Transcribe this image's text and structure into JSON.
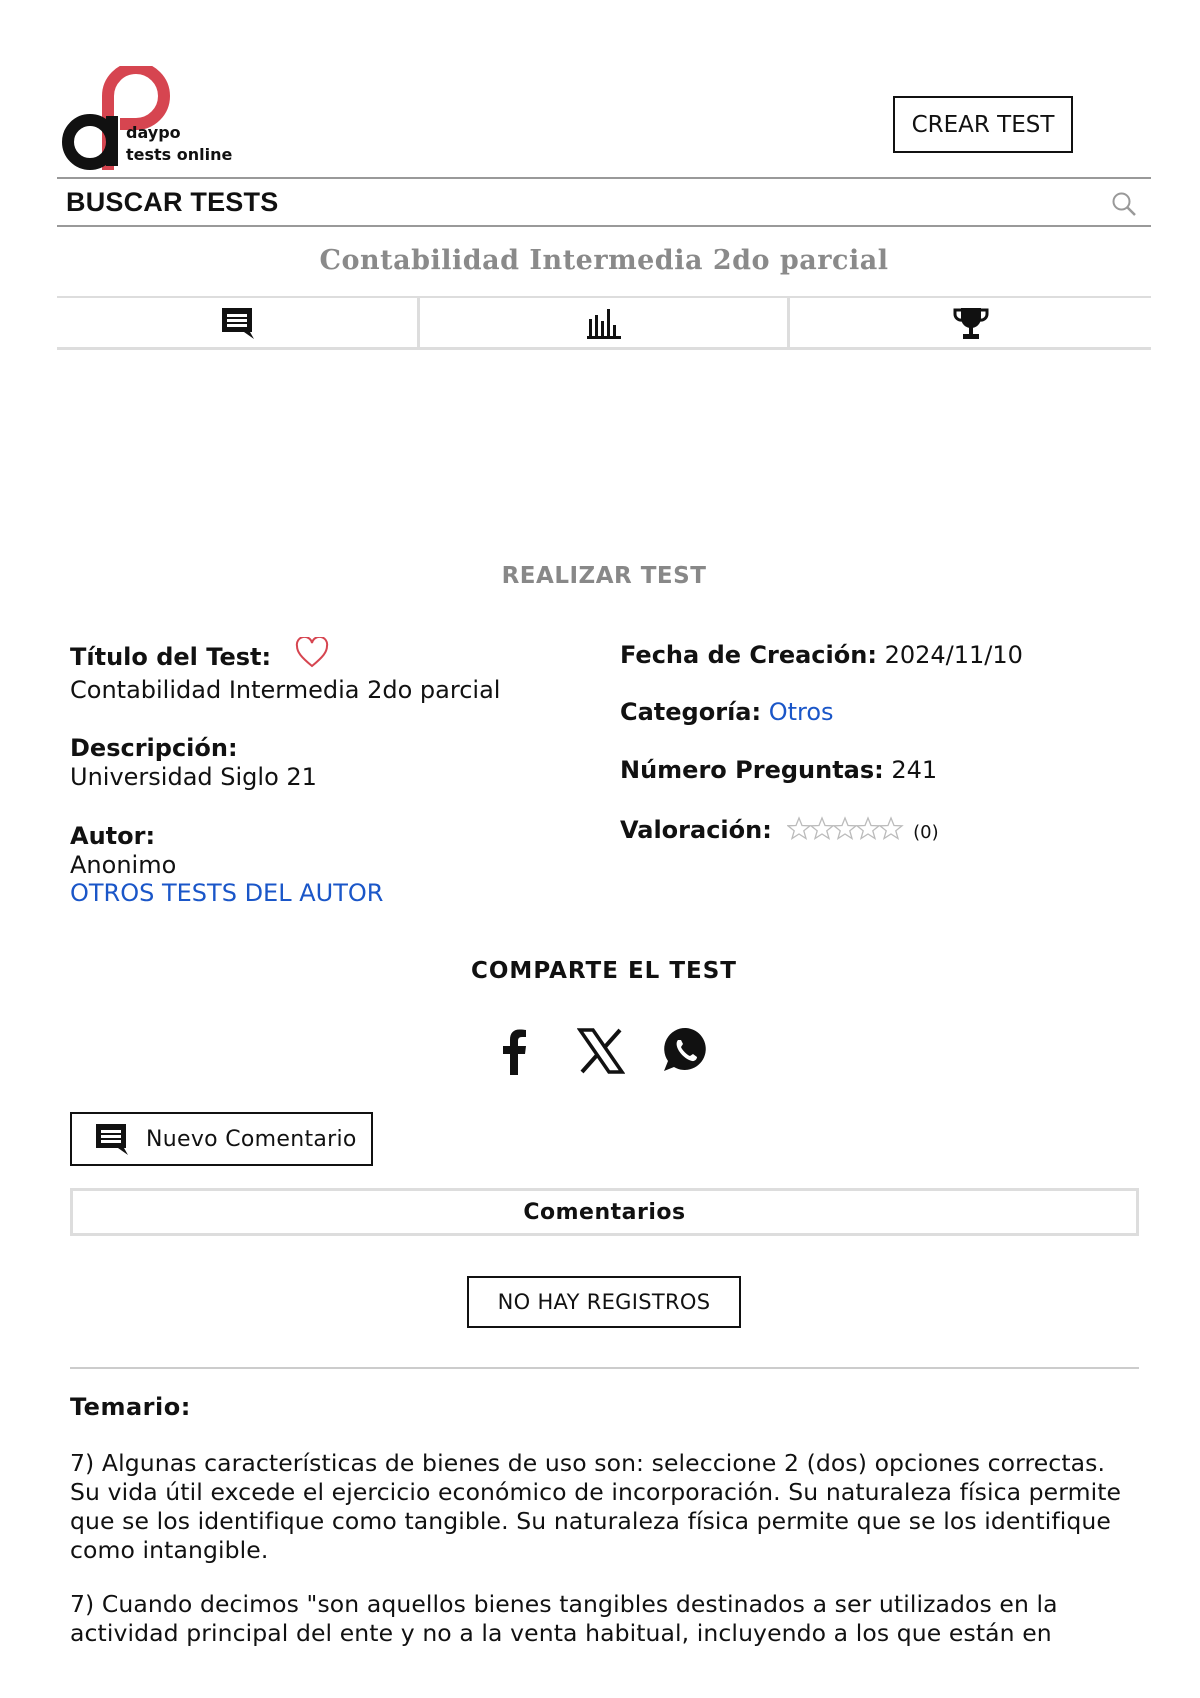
{
  "header": {
    "logo_line1": "daypo",
    "logo_line2": "tests online",
    "crear_label": "CREAR TEST",
    "search_label": "BUSCAR TESTS"
  },
  "test": {
    "title": "Contabilidad Intermedia 2do parcial",
    "realizar_label": "REALIZAR TEST"
  },
  "tabs": [
    {
      "icon": "comment-icon"
    },
    {
      "icon": "stats-icon"
    },
    {
      "icon": "trophy-icon"
    }
  ],
  "details": {
    "titulo_label": "Título del Test:",
    "titulo_value": "Contabilidad Intermedia 2do parcial",
    "descripcion_label": "Descripción:",
    "descripcion_value": "Universidad Siglo 21",
    "autor_label": "Autor:",
    "autor_value": "Anonimo",
    "otros_tests_link": "OTROS TESTS DEL AUTOR",
    "fecha_label": "Fecha de Creación:",
    "fecha_value": "2024/11/10",
    "categoria_label": "Categoría:",
    "categoria_value": "Otros",
    "preguntas_label": "Número Preguntas:",
    "preguntas_value": "241",
    "valoracion_label": "Valoración:",
    "valoracion_stars": 0,
    "valoracion_count": "(0)"
  },
  "share": {
    "title": "COMPARTE EL TEST",
    "icons": [
      "facebook-icon",
      "x-icon",
      "whatsapp-icon"
    ]
  },
  "comments": {
    "nuevo_label": "Nuevo Comentario",
    "header": "Comentarios",
    "empty_label": "NO HAY REGISTROS"
  },
  "temario": {
    "label": "Temario:",
    "items": [
      "7) Algunas características de bienes de uso son: seleccione 2 (dos) opciones correctas. Su vida útil excede el ejercicio económico de incorporación. Su naturaleza física permite que se los identifique como tangible. Su naturaleza física permite que se los identifique como intangible.",
      "7) Cuando decimos \"son aquellos bienes tangibles destinados a ser utilizados en la actividad principal del ente y no a la venta habitual, incluyendo a los que están en"
    ]
  },
  "colors": {
    "brand_red": "#d64550",
    "link_blue": "#1a56c8",
    "muted_gray": "#8a8a8a",
    "border_gray": "#dddddd"
  }
}
